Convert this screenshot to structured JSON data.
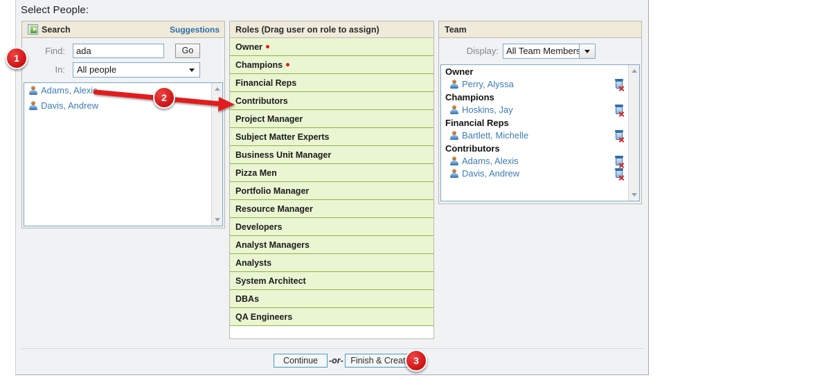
{
  "page": {
    "title": "Select People:"
  },
  "search": {
    "header": "Search",
    "icon": "search-panel-icon",
    "suggestions_link": "Suggestions",
    "find_label": "Find:",
    "find_value": "ada",
    "go_label": "Go",
    "in_label": "In:",
    "in_value": "All people",
    "results": [
      {
        "name": "Adams, Alexis"
      },
      {
        "name": "Davis, Andrew"
      }
    ]
  },
  "roles": {
    "header": "Roles (Drag user on role to assign)",
    "items": [
      {
        "label": "Owner",
        "required": true
      },
      {
        "label": "Champions",
        "required": true
      },
      {
        "label": "Financial Reps",
        "required": false
      },
      {
        "label": "Contributors",
        "required": false
      },
      {
        "label": "Project Manager",
        "required": false
      },
      {
        "label": "Subject Matter Experts",
        "required": false
      },
      {
        "label": "Business Unit Manager",
        "required": false
      },
      {
        "label": "Pizza Men",
        "required": false
      },
      {
        "label": "Portfolio Manager",
        "required": false
      },
      {
        "label": "Resource Manager",
        "required": false
      },
      {
        "label": "Developers",
        "required": false
      },
      {
        "label": "Analyst Managers",
        "required": false
      },
      {
        "label": "Analysts",
        "required": false
      },
      {
        "label": "System Architect",
        "required": false
      },
      {
        "label": "DBAs",
        "required": false
      },
      {
        "label": "QA Engineers",
        "required": false
      }
    ]
  },
  "team": {
    "header": "Team",
    "display_label": "Display:",
    "display_value": "All Team Members",
    "groups": [
      {
        "title": "Owner",
        "members": [
          {
            "name": "Perry, Alyssa"
          }
        ]
      },
      {
        "title": "Champions",
        "members": [
          {
            "name": "Hoskins, Jay"
          }
        ]
      },
      {
        "title": "Financial Reps",
        "members": [
          {
            "name": "Bartlett, Michelle"
          }
        ]
      },
      {
        "title": "Contributors",
        "members": [
          {
            "name": "Adams, Alexis"
          },
          {
            "name": "Davis, Andrew"
          }
        ]
      }
    ]
  },
  "footer": {
    "continue_label": "Continue",
    "or_label": "-or-",
    "finish_label": "Finish & Create!"
  },
  "annotations": {
    "callout_1": "1",
    "callout_2": "2",
    "callout_3": "3",
    "arrow_color": "#e21b1b"
  },
  "colors": {
    "panel_header": "#efeada",
    "role_row": "#eaf5d2",
    "role_border": "#8fb33f",
    "link": "#3d7bb8",
    "required_dot": "#e01b1b",
    "window_bg": "#f1f2f4"
  }
}
